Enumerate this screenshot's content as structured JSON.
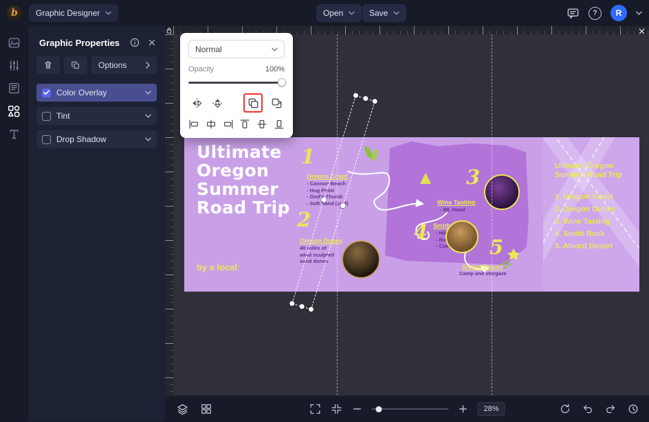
{
  "topbar": {
    "logo_letter": "b",
    "designer_menu_label": "Graphic Designer",
    "open_label": "Open",
    "save_label": "Save",
    "help_glyph": "?",
    "avatar_initial": "R"
  },
  "properties_panel": {
    "title": "Graphic Properties",
    "options_label": "Options",
    "rows": [
      {
        "label": "Color Overlay",
        "checked": true
      },
      {
        "label": "Tint",
        "checked": false
      },
      {
        "label": "Drop Shadow",
        "checked": false
      }
    ]
  },
  "blend_panel": {
    "mode": "Normal",
    "opacity_label": "Opacity",
    "opacity_value": "100%"
  },
  "poster": {
    "title_lines": [
      "Ultimate",
      "Oregon",
      "Summer",
      "Road Trip"
    ],
    "byline": "by a local",
    "stops": [
      {
        "number": "1",
        "name": "Oregon Coast",
        "details": [
          "- Cannon Beach",
          "- Hug Point",
          "- God's Thumb",
          "- Soft Sand (surf)"
        ]
      },
      {
        "number": "2",
        "name": "Oregon Dunes",
        "details": [
          "40 miles of",
          "wind sculpted",
          "sand dunes"
        ]
      },
      {
        "number": "3",
        "name": "Wine Tasting",
        "details": [
          "- Mt. Hood"
        ]
      },
      {
        "number": "4",
        "name": "Smith Rock",
        "details": [
          "- Hike",
          "- Rock Climb",
          "- Camping"
        ]
      },
      {
        "number": "5",
        "name": "Alvord Desert",
        "details": [
          "Camp and stargaze"
        ]
      }
    ],
    "legend_title_lines": [
      "Ultimate Oregon",
      "Summer Road Trip"
    ],
    "legend_items": [
      "1. Oregon Coast",
      "2. Oregon Dunes",
      "3. Wine Tasting",
      "4. Smith Rock",
      "5. Alvord Desert"
    ]
  },
  "statusbar": {
    "zoom_value": "28%"
  },
  "colors": {
    "accent_purple": "#5b63e8",
    "selected_row": "#4a4e91",
    "highlight_red": "#e8352b",
    "poster_bg": "#c9a0e8",
    "poster_map": "#b274d8",
    "poster_yellow": "#ece758",
    "avatar_blue": "#2f6bff"
  }
}
